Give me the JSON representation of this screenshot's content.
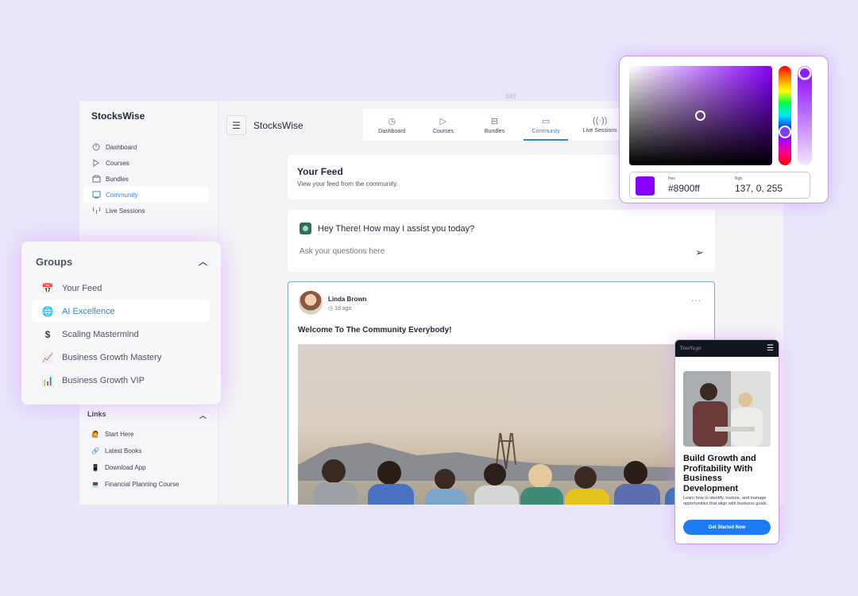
{
  "app": {
    "brand": "StocksWise",
    "sidebar": {
      "items": [
        {
          "label": "Dashboard",
          "icon": "dashboard-icon"
        },
        {
          "label": "Courses",
          "icon": "play-icon"
        },
        {
          "label": "Bundles",
          "icon": "bundle-icon"
        },
        {
          "label": "Community",
          "icon": "community-icon",
          "active": true
        },
        {
          "label": "Live Sessions",
          "icon": "broadcast-icon"
        }
      ],
      "links_heading": "Links",
      "links": [
        {
          "label": "Start Here",
          "icon": "emoji-icon"
        },
        {
          "label": "Latest Books",
          "icon": "link-icon"
        },
        {
          "label": "Download App",
          "icon": "phone-icon"
        },
        {
          "label": "Financial Planning Course",
          "icon": "laptop-icon"
        }
      ]
    },
    "topbar": {
      "brand": "StocksWise",
      "tabs": [
        {
          "label": "Dashboard"
        },
        {
          "label": "Courses"
        },
        {
          "label": "Bundles"
        },
        {
          "label": "Community",
          "active": true
        },
        {
          "label": "Live Sessions"
        }
      ]
    },
    "measure_label": "349",
    "feed": {
      "title": "Your Feed",
      "subtitle": "View your feed from the community."
    },
    "assistant": {
      "greeting": "Hey There! How may I assist you today?",
      "placeholder": "Ask your questions here"
    },
    "post": {
      "author": "Linda Brown",
      "time": "1d ago",
      "text": "Welcome To The Community Everybody!"
    }
  },
  "groups": {
    "heading": "Groups",
    "items": [
      {
        "label": "Your Feed",
        "icon": "calendar-icon"
      },
      {
        "label": "AI Excellence",
        "icon": "globe-icon",
        "active": true
      },
      {
        "label": "Scaling Mastermind",
        "icon": "dollar-icon"
      },
      {
        "label": "Business Growth Mastery",
        "icon": "chart-up-icon"
      },
      {
        "label": "Business Growth VIP",
        "icon": "bar-chart-icon"
      }
    ]
  },
  "picker": {
    "hex_label": "Hex",
    "hex_value": "#8900ff",
    "rgb_label": "Rgb",
    "rgb_value": "137, 0, 255",
    "color": "#8900ff"
  },
  "mobile": {
    "logo": "Yourlogo",
    "title": "Build Growth and Profitability With Business Development",
    "description": "Learn how to identify, nurture, and manage opportunities that align with business goals.",
    "cta": "Get Started Now"
  },
  "colors": {
    "accent": "#3b82c4",
    "background": "#e9e6fb",
    "cta": "#1b7cf3"
  }
}
